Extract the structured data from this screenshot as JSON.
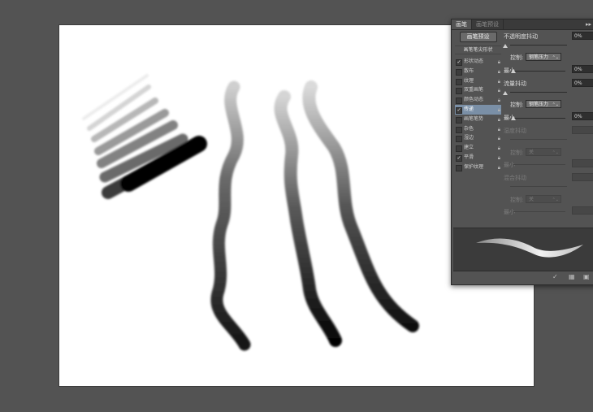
{
  "panel": {
    "tabs": [
      {
        "label": "画笔",
        "active": true
      },
      {
        "label": "画笔预设",
        "active": false
      }
    ],
    "menu_icon": "panel-menu-icon",
    "preset_button": "画笔预设",
    "tip_shape_label": "画笔笔尖形状",
    "options": [
      {
        "label": "形状动态",
        "checked": true,
        "selected": false
      },
      {
        "label": "散布",
        "checked": false,
        "selected": false
      },
      {
        "label": "纹理",
        "checked": false,
        "selected": false
      },
      {
        "label": "双重画笔",
        "checked": false,
        "selected": false
      },
      {
        "label": "颜色动态",
        "checked": false,
        "selected": false
      },
      {
        "label": "传递",
        "checked": true,
        "selected": true
      },
      {
        "label": "画笔笔势",
        "checked": false,
        "selected": false
      },
      {
        "label": "杂色",
        "checked": false,
        "selected": false
      },
      {
        "label": "湿边",
        "checked": false,
        "selected": false
      },
      {
        "label": "建立",
        "checked": false,
        "selected": false
      },
      {
        "label": "平滑",
        "checked": true,
        "selected": false
      },
      {
        "label": "保护纹理",
        "checked": false,
        "selected": false
      }
    ],
    "settings": {
      "opacity_jitter_label": "不透明度抖动",
      "opacity_jitter_value": "0%",
      "control1_label": "控制:",
      "control1_value": "钢笔压力",
      "min1_label": "最小",
      "min1_value": "0%",
      "flow_jitter_label": "流量抖动",
      "flow_jitter_value": "0%",
      "control2_label": "控制:",
      "control2_value": "钢笔压力",
      "min2_label": "最小",
      "min2_value": "0%",
      "wetness_jitter_label": "湿度抖动",
      "control3_label": "控制:",
      "control3_value": "关",
      "min3_label": "最小",
      "mix_jitter_label": "混合抖动",
      "control4_label": "控制:",
      "control4_value": "关",
      "min4_label": "最小"
    },
    "bottom_icons": [
      "toggle-brush-icon",
      "grid-icon",
      "new-preset-icon"
    ]
  }
}
